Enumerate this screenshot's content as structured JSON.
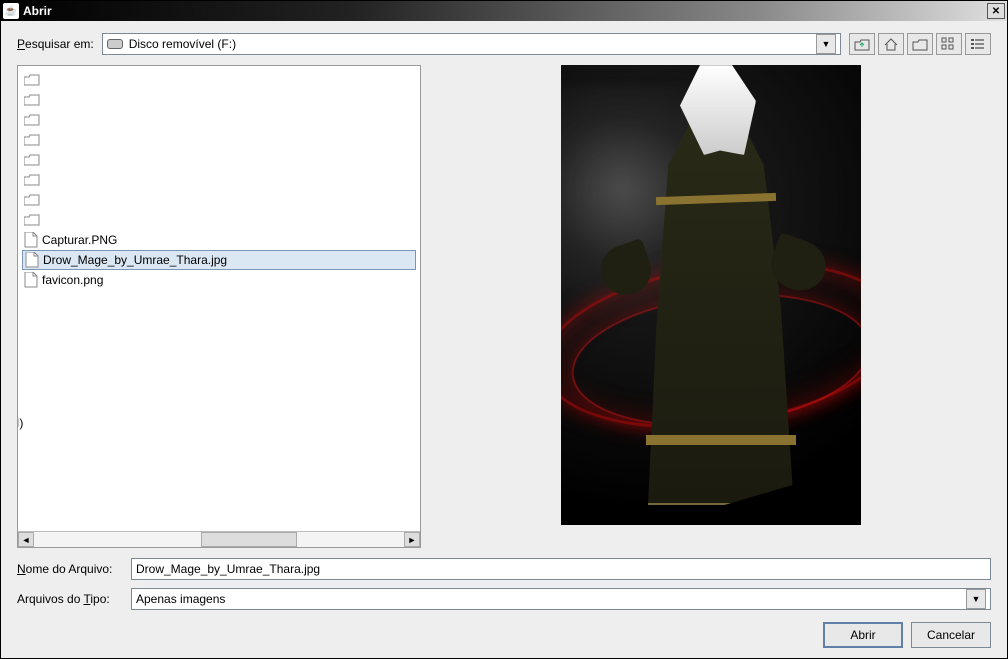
{
  "window": {
    "title": "Abrir"
  },
  "lookin": {
    "label_html": "Pesquisar em:",
    "label_ul": "P",
    "value": "Disco removível (F:)"
  },
  "toolbar": {
    "up": "up-one-level",
    "home": "home",
    "new_folder": "new-folder",
    "list_view": "list-view",
    "details_view": "details-view"
  },
  "files": {
    "folders": [
      "",
      "",
      "",
      "",
      "",
      "",
      "",
      ""
    ],
    "items": [
      {
        "name": "Capturar.PNG",
        "type": "file"
      },
      {
        "name": "Drow_Mage_by_Umrae_Thara.jpg",
        "type": "file",
        "selected": true
      },
      {
        "name": "favicon.png",
        "type": "file"
      }
    ]
  },
  "filename": {
    "label": "Nome do Arquivo:",
    "label_ul": "N",
    "value": "Drow_Mage_by_Umrae_Thara.jpg"
  },
  "filetype": {
    "label": "Arquivos do Tipo:",
    "label_ul": "T",
    "value": "Apenas imagens"
  },
  "buttons": {
    "open": "Abrir",
    "cancel": "Cancelar"
  }
}
